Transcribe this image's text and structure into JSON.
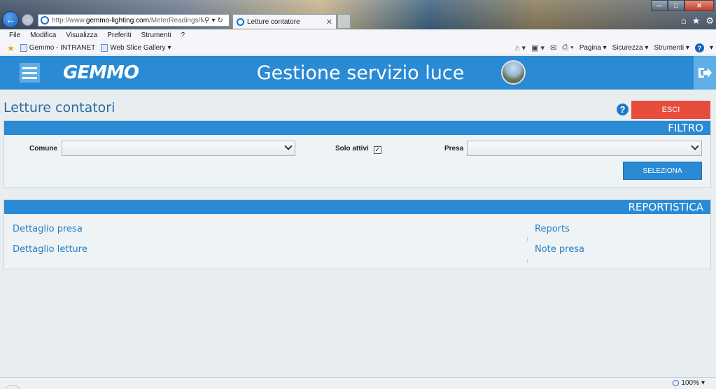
{
  "browser": {
    "url_prefix": "http://www.",
    "url_domain": "gemmo-lighting.com",
    "url_path": "/MeterReadings/Me",
    "tab_title": "Letture contatore",
    "menu": [
      "File",
      "Modifica",
      "Visualizza",
      "Preferiti",
      "Strumenti",
      "?"
    ],
    "favorites": [
      "Gemmo - INTRANET",
      "Web Slice Gallery"
    ],
    "commands": {
      "page": "Pagina",
      "security": "Sicurezza",
      "tools": "Strumenti"
    },
    "zoom": "100%"
  },
  "app": {
    "logo": "GEMMO",
    "title": "Gestione servizio luce"
  },
  "page": {
    "title": "Letture contatori",
    "exit_label": "ESCI"
  },
  "filter": {
    "header": "FILTRO",
    "comune_label": "Comune",
    "comune_value": "",
    "solo_attivi_label": "Solo attivi",
    "solo_attivi_checked": true,
    "presa_label": "Presa",
    "presa_value": "",
    "submit_label": "SELEZIONA"
  },
  "report": {
    "header": "REPORTISTICA",
    "links_left": [
      "Dettaglio presa",
      "Dettaglio letture"
    ],
    "links_right": [
      "Reports",
      "Note presa"
    ]
  },
  "colors": {
    "primary": "#2a8ad4",
    "danger": "#e84c3d",
    "link": "#2a7ec4"
  }
}
